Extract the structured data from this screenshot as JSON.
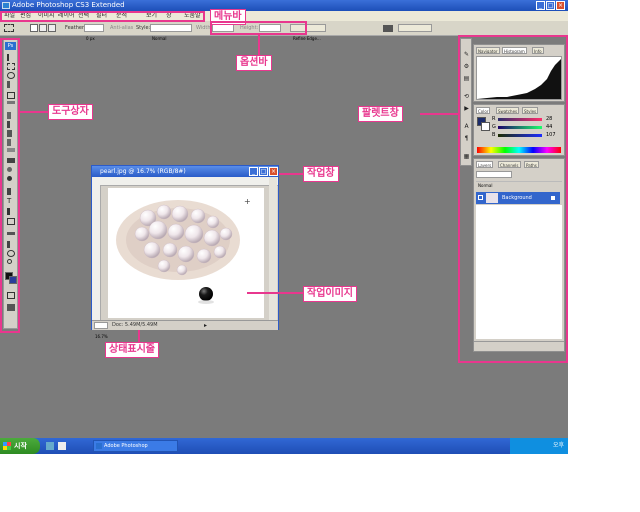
{
  "window": {
    "title": "Adobe Photoshop CS3 Extended"
  },
  "menubar": {
    "items": [
      "파일",
      "편집",
      "이미지",
      "레이어",
      "선택",
      "필터",
      "분석",
      "보기",
      "창",
      "도움말"
    ]
  },
  "options": {
    "feather_label": "Feather:",
    "feather_value": "0 px",
    "antialias_label": "Anti-alias",
    "style_label": "Style:",
    "style_value": "Normal",
    "width_label": "Width:",
    "height_label": "Height:",
    "refine_edge": "Refine Edge..."
  },
  "document": {
    "title": "pearl.jpg @ 16.7% (RGB/8#)",
    "zoom": "16.7%",
    "status": "Doc: 5.49M/5.49M"
  },
  "palettes": {
    "nav_tabs": [
      "Navigator",
      "Histogram",
      "Info"
    ],
    "color_tabs": [
      "Color",
      "Swatches",
      "Styles"
    ],
    "color_values": [
      "R",
      "G",
      "B"
    ],
    "color_numbers": [
      "28",
      "44",
      "107"
    ],
    "layer_tabs": [
      "Layers",
      "Channels",
      "Paths"
    ],
    "blend_mode": "Normal",
    "layer_name": "Background"
  },
  "taskbar": {
    "start": "시작",
    "task": "Adobe Photoshop",
    "clock": "오후"
  },
  "annotations": {
    "menubar": "메뉴바",
    "optionbar": "옵션바",
    "toolbox": "도구상자",
    "palette": "팔렛트창",
    "docwindow": "작업창",
    "image": "작업이미지",
    "statusbar": "상태표시줄"
  },
  "colors": {
    "accent": "#e8378e",
    "titlebar": "#2a5cc8",
    "canvas_gray": "#7b7b7b"
  }
}
